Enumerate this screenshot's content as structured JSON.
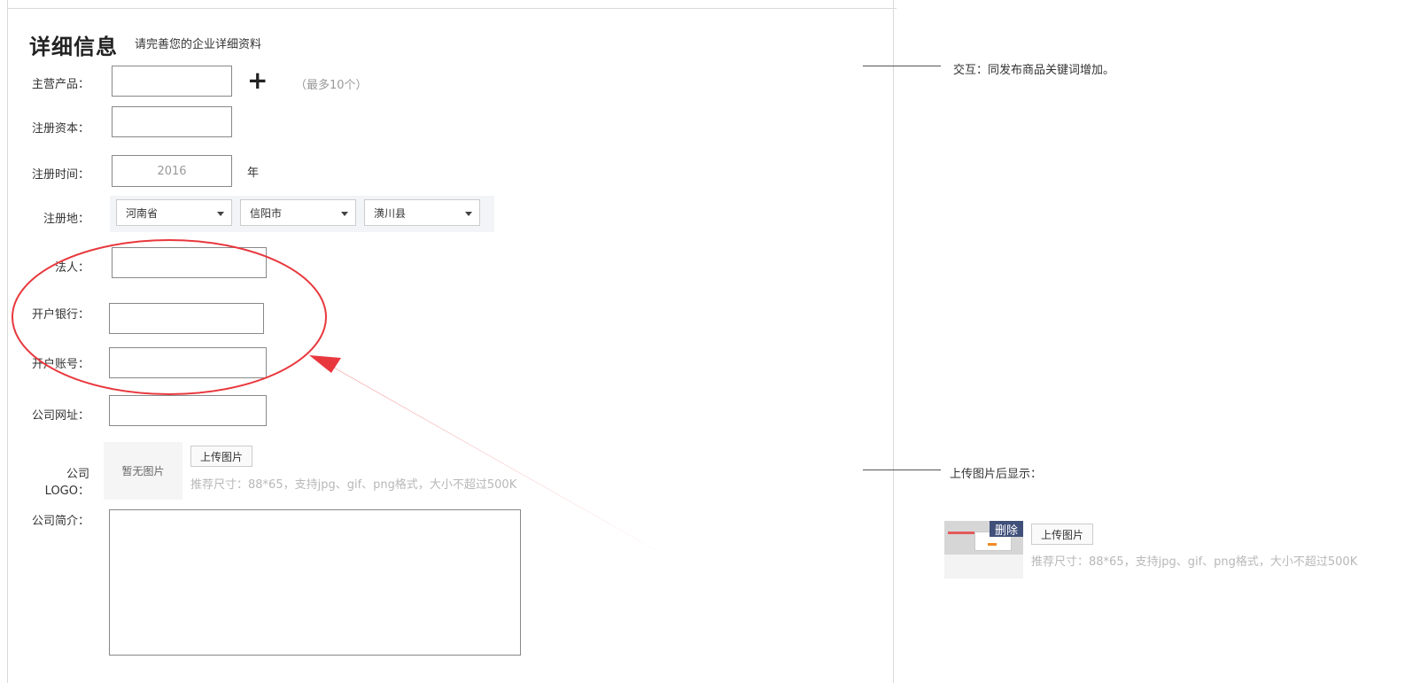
{
  "header": {
    "title": "详细信息",
    "subtitle": "请完善您的企业详细资料"
  },
  "form": {
    "main_product": {
      "label": "主营产品：",
      "value": "",
      "add_icon": "plus-icon",
      "hint": "（最多10个）"
    },
    "registered_capital": {
      "label": "注册资本：",
      "value": ""
    },
    "registration_time": {
      "label": "注册时间：",
      "value": "2016",
      "unit": "年"
    },
    "registration_place": {
      "label": "注册地：",
      "province": "河南省",
      "city": "信阳市",
      "county": "潢川县"
    },
    "legal_person": {
      "label": "法人：",
      "value": ""
    },
    "bank": {
      "label": "开户银行：",
      "value": ""
    },
    "account": {
      "label": "开户账号：",
      "value": ""
    },
    "website": {
      "label": "公司网址：",
      "value": ""
    },
    "logo": {
      "label": "公司LOGO：",
      "placeholder": "暂无图片",
      "upload_button": "上传图片",
      "hint": "推荐尺寸：88*65，支持jpg、gif、png格式，大小不超过500K"
    },
    "intro": {
      "label": "公司简介：",
      "value": ""
    }
  },
  "notes": {
    "interaction": "交互：同发布商品关键词增加。",
    "after_upload": "上传图片后显示：",
    "preview": {
      "delete_label": "删除",
      "upload_button": "上传图片",
      "hint": "推荐尺寸：88*65，支持jpg、gif、png格式，大小不超过500K"
    }
  },
  "colors": {
    "annotation_red": "#e8383d",
    "delete_tag_bg": "#40507a",
    "region_bg": "#f3f4f7"
  }
}
